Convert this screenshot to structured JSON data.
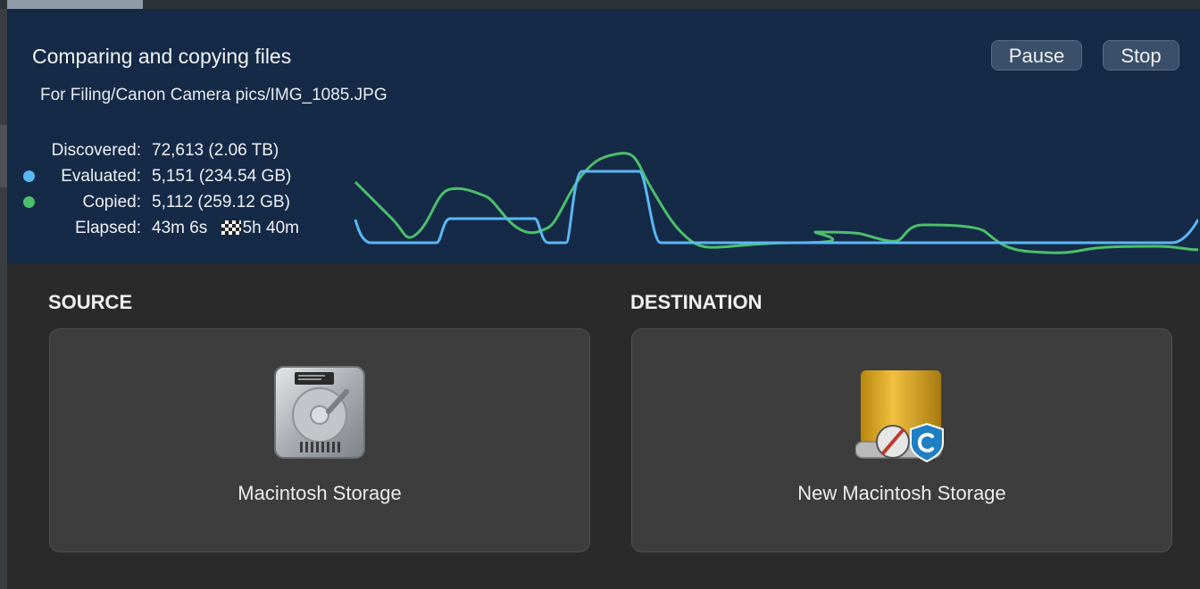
{
  "progress": {
    "title": "Comparing and copying files",
    "current_path": "For Filing/Canon Camera pics/IMG_1085.JPG",
    "pause_label": "Pause",
    "stop_label": "Stop",
    "stats": {
      "discovered_label": "Discovered:",
      "discovered_value": "72,613 (2.06 TB)",
      "evaluated_label": "Evaluated:",
      "evaluated_value": "5,151 (234.54 GB)",
      "copied_label": "Copied:",
      "copied_value": "5,112 (259.12 GB)",
      "elapsed_label": "Elapsed:",
      "elapsed_value": "43m 6s",
      "remaining_value": "5h 40m"
    },
    "colors": {
      "evaluated": "#5ab8f5",
      "copied": "#4cbf6a",
      "background": "#152a47"
    }
  },
  "source": {
    "label": "SOURCE",
    "volume_name": "Macintosh Storage",
    "icon": "internal-hard-drive-icon"
  },
  "destination": {
    "label": "DESTINATION",
    "volume_name": "New Macintosh Storage",
    "icon": "external-drive-icon"
  }
}
